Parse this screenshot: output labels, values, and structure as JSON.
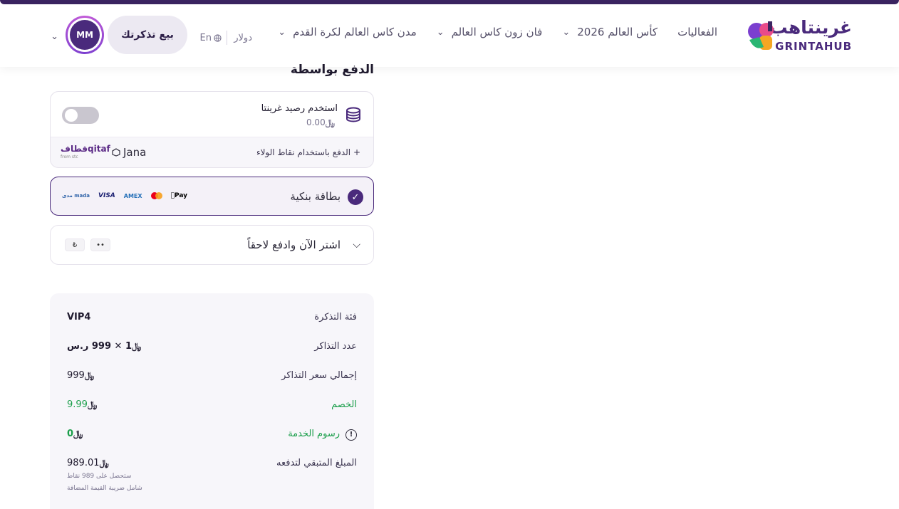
{
  "header": {
    "logo_ar": "غرينتاهب",
    "logo_en": "GRINTAHUB",
    "nav": [
      {
        "label": "الفعاليات"
      },
      {
        "label": "كأس العالم 2026"
      },
      {
        "label": "فان زون كاس العالم"
      },
      {
        "label": "مدن كاس العالم لكرة القدم"
      }
    ],
    "currency": "دولار",
    "lang": "En",
    "sell_button": "بيع تذكرتك",
    "avatar_initials": "MM"
  },
  "payment": {
    "title": "الدفع بواسطة",
    "wallet_label": "استخدم رصيد غرينتا",
    "wallet_balance": "0.00",
    "loyalty_label": "الدفع باستخدام نقاط الولاء",
    "jana_label": "Jana",
    "qitaf_label": "قطافqitaf",
    "qitaf_sub": "from stc",
    "bank_card_label": "بطاقة بنكية",
    "brands": {
      "mada": "مدى mada",
      "visa": "VISA",
      "amex": "AMEX",
      "apple": "Pay"
    },
    "bnpl_label": "اشتر الآن وادفع لاحقاً",
    "bnpl_badges": [
      "••",
      "₺"
    ]
  },
  "summary": {
    "rows": [
      {
        "label": "فئة التذكرة",
        "value": "VIP4"
      },
      {
        "label": "عدد التذاكر",
        "value": "1 ✕ 999 ر.س"
      },
      {
        "label": "إجمالي سعر التذاكر",
        "value": "999"
      },
      {
        "label": "الخصم",
        "value": "9.99"
      },
      {
        "label": "رسوم الخدمة",
        "value": "0"
      },
      {
        "label": "المبلغ المتبقي لتدفعه",
        "value": "989.01"
      }
    ],
    "points_note": "ستحصل على 989 نقاط",
    "vat_note": "شامل ضريبة القيمة المضافة"
  },
  "currency_symbol": "﷼",
  "colors": {
    "brand": "#4a2a7c",
    "green": "#1a9e4a"
  }
}
